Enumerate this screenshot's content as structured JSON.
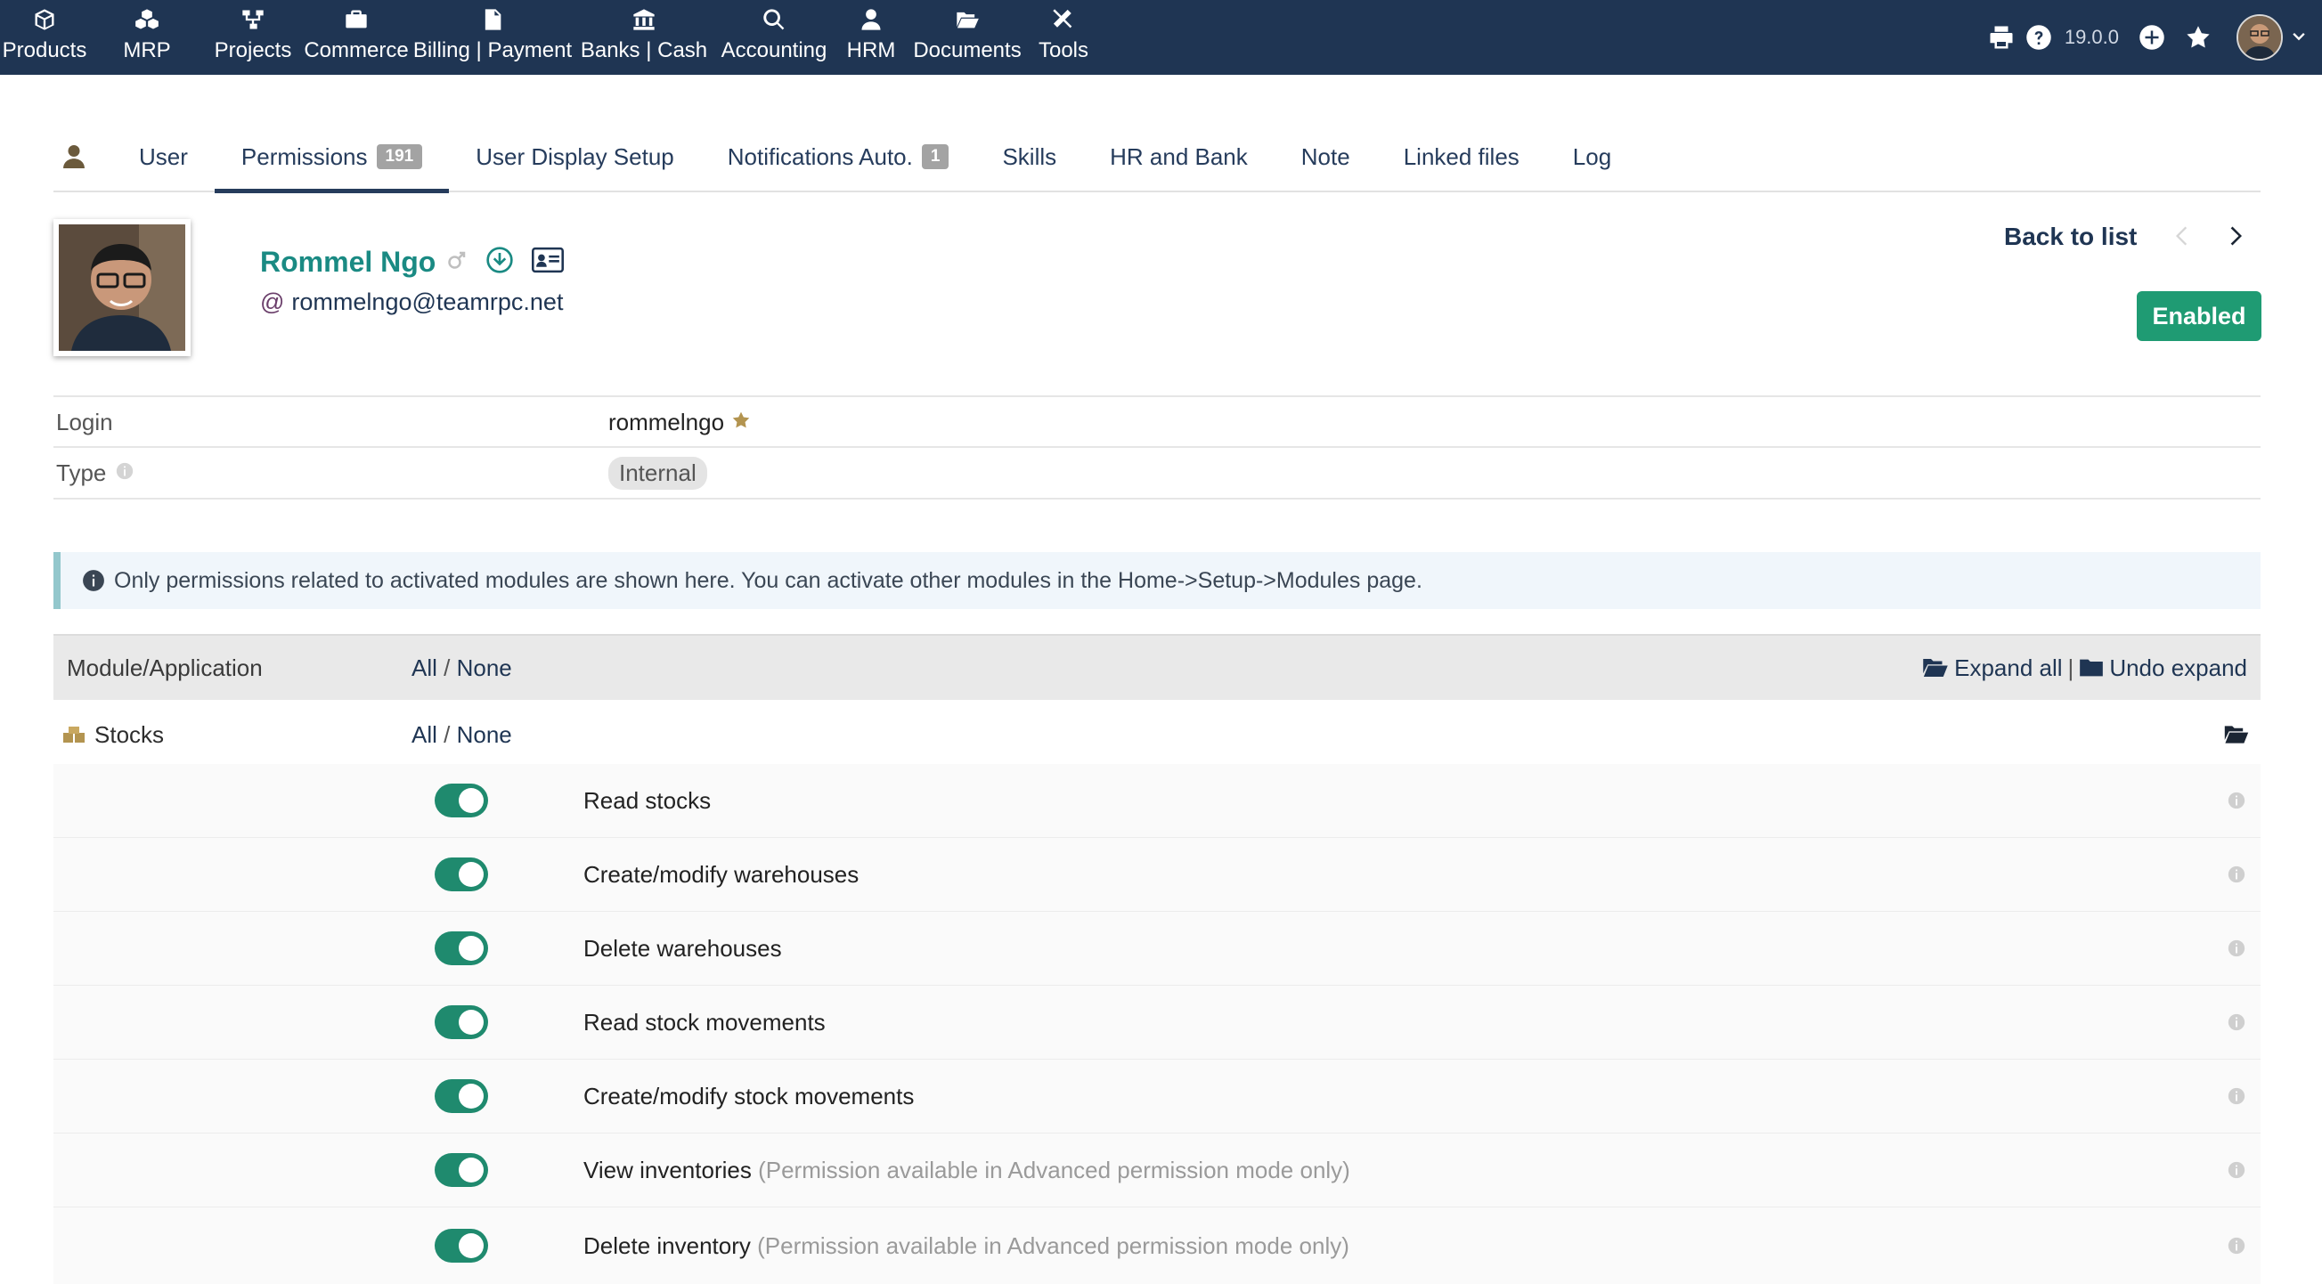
{
  "topbar": {
    "menu": [
      {
        "label": "Products",
        "icon": "cube-icon"
      },
      {
        "label": "MRP",
        "icon": "cubes-icon"
      },
      {
        "label": "Projects",
        "icon": "project-diagram-icon"
      },
      {
        "label": "Commerce",
        "icon": "briefcase-icon"
      },
      {
        "label": "Billing | Payment",
        "icon": "invoice-icon"
      },
      {
        "label": "Banks | Cash",
        "icon": "bank-icon"
      },
      {
        "label": "Accounting",
        "icon": "search-dollar-icon"
      },
      {
        "label": "HRM",
        "icon": "user-tie-icon"
      },
      {
        "label": "Documents",
        "icon": "folder-open-icon"
      },
      {
        "label": "Tools",
        "icon": "tools-icon"
      }
    ],
    "version": "19.0.0"
  },
  "tabs": [
    {
      "label": "User",
      "badge": ""
    },
    {
      "label": "Permissions",
      "badge": "191"
    },
    {
      "label": "User Display Setup",
      "badge": ""
    },
    {
      "label": "Notifications Auto.",
      "badge": "1"
    },
    {
      "label": "Skills",
      "badge": ""
    },
    {
      "label": "HR and Bank",
      "badge": ""
    },
    {
      "label": "Note",
      "badge": ""
    },
    {
      "label": "Linked files",
      "badge": ""
    },
    {
      "label": "Log",
      "badge": ""
    }
  ],
  "user": {
    "name": "Rommel Ngo",
    "email": "rommelngo@teamrpc.net",
    "status": "Enabled"
  },
  "nav": {
    "back": "Back to list"
  },
  "fields": {
    "login_label": "Login",
    "login_value": "rommelngo",
    "type_label": "Type",
    "type_value": "Internal"
  },
  "info_message": "Only permissions related to activated modules are shown here. You can activate other modules in the Home->Setup->Modules page.",
  "perm_table": {
    "col_module": "Module/Application",
    "all": "All",
    "slash": "/",
    "none": "None",
    "expand_all": "Expand all",
    "separator": "|",
    "undo_expand": "Undo expand",
    "module": "Stocks",
    "permissions": [
      {
        "label": "Read stocks",
        "note": "",
        "enabled": true
      },
      {
        "label": "Create/modify warehouses",
        "note": "",
        "enabled": true
      },
      {
        "label": "Delete warehouses",
        "note": "",
        "enabled": true
      },
      {
        "label": "Read stock movements",
        "note": "",
        "enabled": true
      },
      {
        "label": "Create/modify stock movements",
        "note": "",
        "enabled": true
      },
      {
        "label": "View inventories",
        "note": "(Permission available in Advanced permission mode only)",
        "enabled": true
      },
      {
        "label": "Delete inventory",
        "note": "(Permission available in Advanced permission mode only)",
        "enabled": true
      }
    ]
  },
  "colors": {
    "topbar": "#1f3553",
    "accent": "#1a8a83",
    "toggle_on": "#1f8a6e",
    "enabled_badge": "#1f9b73"
  }
}
